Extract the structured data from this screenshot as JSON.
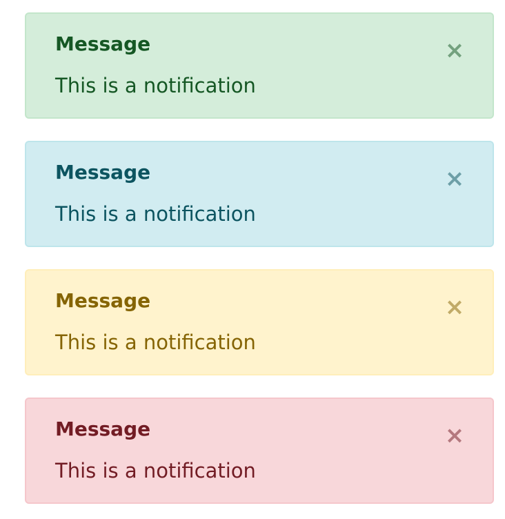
{
  "alerts": [
    {
      "variant": "success",
      "title": "Message",
      "text": "This is a notification",
      "close_icon": "×",
      "icon_name": "close-icon",
      "colors": {
        "background": "#d4edda",
        "border": "#c3e6cb",
        "text": "#155724"
      }
    },
    {
      "variant": "info",
      "title": "Message",
      "text": "This is a notification",
      "close_icon": "×",
      "icon_name": "close-icon",
      "colors": {
        "background": "#d1ecf1",
        "border": "#bee5eb",
        "text": "#0c5460"
      }
    },
    {
      "variant": "warning",
      "title": "Message",
      "text": "This is a notification",
      "close_icon": "×",
      "icon_name": "close-icon",
      "colors": {
        "background": "#fff3cd",
        "border": "#ffeeba",
        "text": "#856404"
      }
    },
    {
      "variant": "danger",
      "title": "Message",
      "text": "This is a notification",
      "close_icon": "×",
      "icon_name": "close-icon",
      "colors": {
        "background": "#f8d7da",
        "border": "#f5c6cb",
        "text": "#721c24"
      }
    }
  ]
}
